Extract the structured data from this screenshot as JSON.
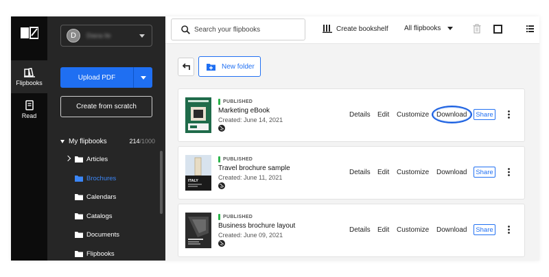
{
  "rail": {
    "items": [
      {
        "label": "Flipbooks",
        "icon": "book-icon",
        "active": true
      },
      {
        "label": "Read",
        "icon": "reader-icon",
        "active": false
      }
    ]
  },
  "account": {
    "avatar_letter": "D",
    "name": "Diana Ile"
  },
  "sidebar": {
    "upload_label": "Upload PDF",
    "scratch_label": "Create from scratch",
    "tree": {
      "title": "My flipbooks",
      "count": "214",
      "total": "/1000",
      "folders": [
        {
          "label": "Articles",
          "expandable": true,
          "active": false
        },
        {
          "label": "Brochures",
          "expandable": false,
          "active": true
        },
        {
          "label": "Calendars",
          "expandable": false,
          "active": false
        },
        {
          "label": "Catalogs",
          "expandable": false,
          "active": false
        },
        {
          "label": "Documents",
          "expandable": false,
          "active": false
        },
        {
          "label": "Flipbooks",
          "expandable": false,
          "active": false
        }
      ]
    }
  },
  "topbar": {
    "search_placeholder": "Search your flipbooks",
    "bookshelf_label": "Create bookshelf",
    "filter_label": "All flipbooks"
  },
  "toolbar": {
    "new_folder_label": "New folder"
  },
  "actions": {
    "details": "Details",
    "edit": "Edit",
    "customize": "Customize",
    "download": "Download",
    "share": "Share"
  },
  "rows": [
    {
      "status": "PUBLISHED",
      "title": "Marketing eBook",
      "created": "Created: June 14, 2021",
      "highlight_download": true
    },
    {
      "status": "PUBLISHED",
      "title": "Travel brochure sample",
      "created": "Created: June 11, 2021",
      "highlight_download": false
    },
    {
      "status": "PUBLISHED",
      "title": "Business brochure layout",
      "created": "Created: June 09, 2021",
      "highlight_download": false
    }
  ],
  "thumbnails": [
    {
      "caption": "",
      "overlay": ""
    },
    {
      "caption": "ITALY",
      "overlay": ""
    },
    {
      "caption": "",
      "overlay": ""
    }
  ],
  "colors": {
    "accent": "#1f6ff2",
    "published": "#2bb34a",
    "rail": "#0c0c0c",
    "sidebar": "#262626"
  }
}
